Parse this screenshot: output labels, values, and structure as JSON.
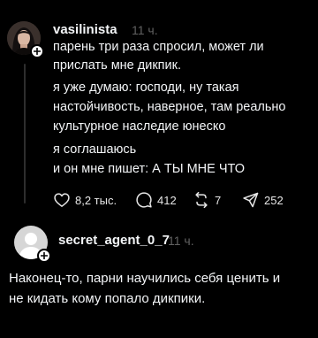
{
  "post": {
    "username": "vasilinista",
    "time": "11 ч.",
    "lines": [
      "парень три раза спросил, может ли",
      "прислать мне дикпик.",
      "я уже думаю: господи, ну такая",
      "настойчивость, наверное, там реально",
      "культурное наследие юнеско",
      "я соглашаюсь",
      "и он мне пишет: А ТЫ МНЕ ЧТО"
    ],
    "actions": {
      "likes": "8,2 тыс.",
      "comments": "412",
      "reposts": "7",
      "shares": "252"
    }
  },
  "reply": {
    "username": "secret_agent_0_7",
    "time": "11 ч.",
    "lines": [
      "Наконец-то, парни научились себя ценить и",
      "не кидать кому попало дикпики."
    ]
  },
  "icons": {
    "like": "heart-icon",
    "comment": "speech-bubble-icon",
    "repost": "repost-icon",
    "share": "send-icon",
    "follow": "plus-icon"
  },
  "colors": {
    "background": "#000000",
    "text": "#f3f5f7",
    "muted": "#616161",
    "thread_line": "#2e2e2e"
  }
}
